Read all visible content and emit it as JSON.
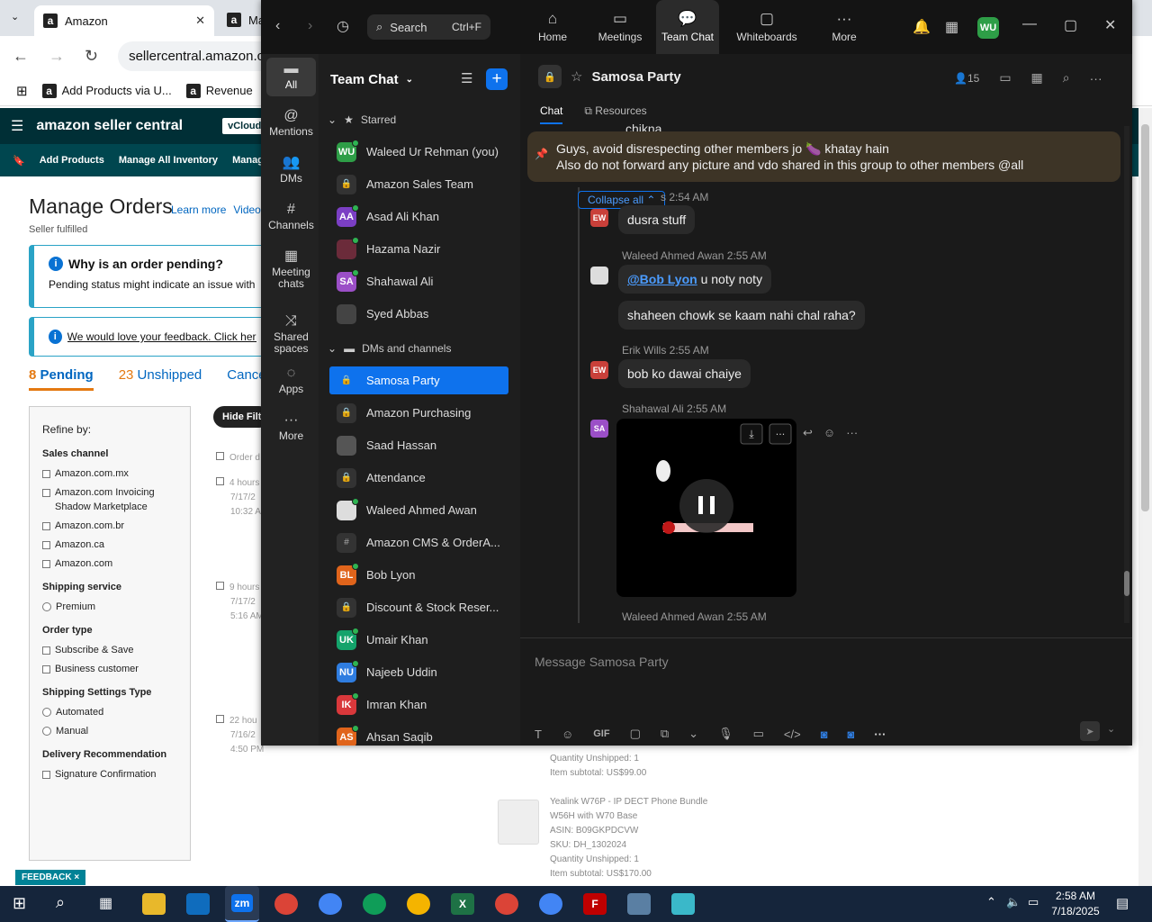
{
  "browser": {
    "tabs": [
      {
        "label": "Amazon"
      },
      {
        "label": "Ma"
      }
    ],
    "url": "sellercentral.amazon.c",
    "bookmarks": [
      {
        "label": "Add Products via U..."
      },
      {
        "label": "Revenue"
      }
    ]
  },
  "amazon": {
    "logo": "amazon seller central",
    "account": "vCloudTech",
    "nav": [
      "Add Products",
      "Manage All Inventory",
      "Manage F"
    ],
    "page_title": "Manage Orders",
    "links": [
      "Learn more",
      "Video"
    ],
    "subtitle": "Seller fulfilled",
    "info_title": "Why is an order pending?",
    "info_text": "Pending status might indicate an issue with th",
    "feedback_text": "We would love your feedback. Click here to",
    "order_tabs": [
      {
        "count": "8",
        "label": "Pending"
      },
      {
        "count": "23",
        "label": "Unshipped"
      },
      {
        "count": "",
        "label": "Cancele"
      }
    ],
    "hide_filters": "Hide Filt",
    "refine": {
      "title": "Refine by:",
      "groups": [
        {
          "title": "Sales channel",
          "type": "check",
          "options": [
            "Amazon.com.mx",
            "Amazon.com Invoicing Shadow Marketplace",
            "Amazon.com.br",
            "Amazon.ca",
            "Amazon.com"
          ]
        },
        {
          "title": "Shipping service",
          "type": "radio",
          "options": [
            "Premium"
          ]
        },
        {
          "title": "Order type",
          "type": "check",
          "options": [
            "Subscribe & Save",
            "Business customer"
          ]
        },
        {
          "title": "Shipping Settings Type",
          "type": "radio",
          "options": [
            "Automated",
            "Manual"
          ]
        },
        {
          "title": "Delivery Recommendation",
          "type": "check",
          "options": [
            "Signature Confirmation"
          ]
        }
      ]
    },
    "ghost_rows": [
      {
        "lines": [
          "Order d"
        ]
      },
      {
        "lines": [
          "4 hours",
          "7/17/2",
          "10:32 A"
        ]
      },
      {
        "lines": [
          "9 hours",
          "7/17/2",
          "5:16 AM"
        ]
      },
      {
        "lines": [
          "22 hou",
          "7/16/2",
          "4:50 PM"
        ]
      }
    ],
    "product_lines": [
      "Quantity Unshipped: 1",
      "Item subtotal: US$99.00",
      "",
      "Yealink W76P - IP DECT Phone Bundle",
      "W56H with W70 Base",
      "ASIN: B09GKPDCVW",
      "SKU: DH_1302024",
      "Quantity Unshipped: 1",
      "Item subtotal: US$170.00"
    ],
    "feedback_tab": "FEEDBACK ×"
  },
  "zoom": {
    "search": {
      "label": "Search",
      "shortcut": "Ctrl+F"
    },
    "top_nav": [
      {
        "label": "Home",
        "icon": "home-icon"
      },
      {
        "label": "Meetings",
        "icon": "video-icon"
      },
      {
        "label": "Team Chat",
        "icon": "chat-icon"
      },
      {
        "label": "Whiteboards",
        "icon": "whiteboard-icon"
      },
      {
        "label": "More",
        "icon": "more-icon"
      }
    ],
    "user_initials": "WU",
    "rail": [
      {
        "label": "All",
        "icon": "chat-bubble-icon"
      },
      {
        "label": "Mentions",
        "icon": "at-icon"
      },
      {
        "label": "DMs",
        "icon": "people-icon"
      },
      {
        "label": "Channels",
        "icon": "hash-icon"
      },
      {
        "label": "Meeting chats",
        "icon": "calendar-icon"
      },
      {
        "label": "Shared spaces",
        "icon": "share-icon"
      },
      {
        "label": "Apps",
        "icon": "apps-icon"
      },
      {
        "label": "More",
        "icon": "more-icon"
      }
    ],
    "list_title": "Team Chat",
    "starred_label": "Starred",
    "dms_label": "DMs and channels",
    "starred": [
      {
        "name": "Waleed Ur Rehman (you)",
        "kind": "avatar",
        "initials": "WU",
        "color": "#2e9e47",
        "online": true
      },
      {
        "name": "Amazon Sales Team",
        "kind": "lock"
      },
      {
        "name": "Asad Ali Khan",
        "kind": "avatar",
        "initials": "AA",
        "color": "#7b3fc4",
        "online": true
      },
      {
        "name": "Hazama Nazir",
        "kind": "avatar",
        "initials": "",
        "color": "#6b2b3a",
        "online": true
      },
      {
        "name": "Shahawal Ali",
        "kind": "avatar",
        "initials": "SA",
        "color": "#9b4fc7",
        "online": true
      },
      {
        "name": "Syed Abbas",
        "kind": "avatar",
        "initials": "",
        "color": "#444",
        "online": false
      }
    ],
    "channels": [
      {
        "name": "Samosa Party",
        "kind": "lock",
        "selected": true
      },
      {
        "name": "Amazon Purchasing",
        "kind": "lock"
      },
      {
        "name": "Saad Hassan",
        "kind": "avatar",
        "initials": "",
        "color": "#555",
        "online": false
      },
      {
        "name": "Attendance",
        "kind": "lock"
      },
      {
        "name": "Waleed Ahmed Awan",
        "kind": "avatar",
        "initials": "",
        "color": "#ddd",
        "online": true
      },
      {
        "name": "Amazon CMS & OrderA...",
        "kind": "hash"
      },
      {
        "name": "Bob Lyon",
        "kind": "avatar",
        "initials": "BL",
        "color": "#e0641b",
        "online": true
      },
      {
        "name": "Discount & Stock Reser...",
        "kind": "lock"
      },
      {
        "name": "Umair Khan",
        "kind": "avatar",
        "initials": "UK",
        "color": "#14a36b",
        "online": true
      },
      {
        "name": "Najeeb Uddin",
        "kind": "avatar",
        "initials": "NU",
        "color": "#2f7de0",
        "online": true
      },
      {
        "name": "Imran Khan",
        "kind": "avatar",
        "initials": "IK",
        "color": "#d9383b",
        "online": true
      },
      {
        "name": "Ahsan Saqib",
        "kind": "avatar",
        "initials": "AS",
        "color": "#e0641b",
        "online": true
      }
    ],
    "chat": {
      "title": "Samosa Party",
      "members": "15",
      "tabs": [
        "Chat",
        "Resources"
      ],
      "cut_text": "chikna",
      "pinned": [
        "Guys, avoid disrespecting other members jo 🍆 khatay hain",
        "Also do not forward any picture and vdo shared in this group to other members @all"
      ],
      "collapse": "Collapse all",
      "messages": [
        {
          "sender": "s",
          "time": "2:54 AM",
          "initials": "EW",
          "color": "#c9403a",
          "bubbles": [
            "dusra stuff"
          ]
        },
        {
          "sender": "Waleed Ahmed Awan",
          "time": "2:55 AM",
          "initials": "",
          "color": "#ddd",
          "mention": "@Bob Lyon",
          "bubbles": [
            "u noty noty",
            "shaheen chowk se kaam nahi chal raha?"
          ]
        },
        {
          "sender": "Erik Wills",
          "time": "2:55 AM",
          "initials": "EW",
          "color": "#c9403a",
          "bubbles": [
            "bob ko dawai chaiye"
          ]
        },
        {
          "sender": "Shahawal Ali",
          "time": "2:55 AM",
          "initials": "SA",
          "color": "#9b4fc7",
          "bubbles": []
        },
        {
          "sender": "Waleed Ahmed Awan",
          "time": "2:55 AM"
        }
      ],
      "composer_placeholder": "Message Samosa Party",
      "composer_tools": [
        "T",
        "☺",
        "GIF",
        "▢",
        "⧉",
        "⌄",
        "🎙",
        "▭",
        "</>",
        "◙",
        "◙",
        "···"
      ]
    }
  },
  "taskbar": {
    "time": "2:58 AM",
    "date": "7/18/2025",
    "apps": [
      "zm",
      "X",
      "F"
    ]
  }
}
